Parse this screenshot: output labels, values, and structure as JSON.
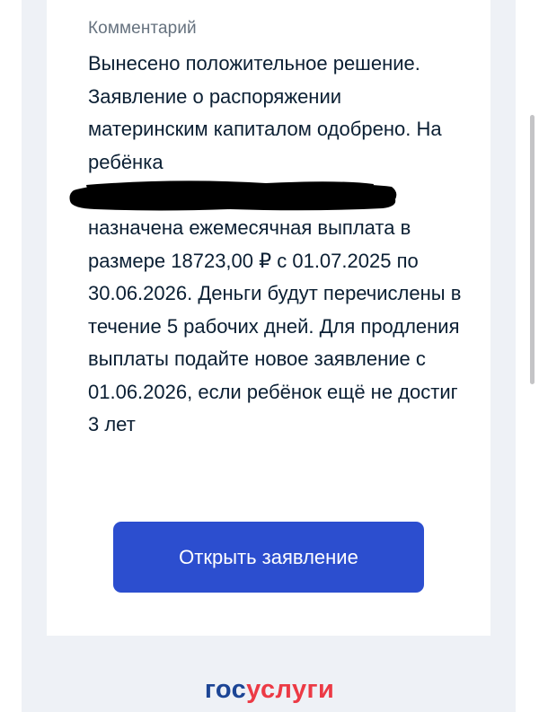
{
  "comment": {
    "label": "Комментарий",
    "text_part1": "Вынесено положительное решение. Заявление о распоряжении материнским капиталом одобрено. На ребёнка",
    "text_part2": "назначена ежемесячная выплата в размере 18723,00 ₽ с 01.07.2025 по 30.06.2026. Деньги будут перечислены в течение 5 рабочих дней. Для продления выплаты подайте новое заявление с 01.06.2026, если ребёнок ещё не достиг 3 лет"
  },
  "actions": {
    "open_application_label": "Открыть заявление"
  },
  "footer": {
    "logo_part1": "гос",
    "logo_part2": "услуги"
  },
  "colors": {
    "accent": "#2c4ecf",
    "text": "#0b1f33",
    "muted": "#66727f",
    "background": "#eef1f6",
    "logo_blue": "#1c4595",
    "logo_red": "#ec3a45"
  }
}
